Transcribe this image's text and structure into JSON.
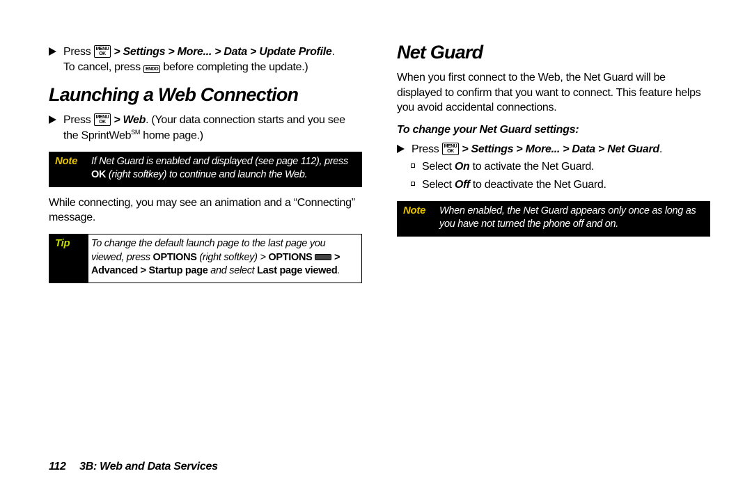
{
  "left": {
    "intro": {
      "press": "Press",
      "path": "> Settings > More... > Data > Update Profile",
      "cancel1": "To cancel, press",
      "cancel2": "before completing the update.)"
    },
    "h1": "Launching a Web Connection",
    "launch": {
      "press": "Press",
      "web": "> Web",
      "rest1": ". (Your data connection starts and you see the SprintWeb",
      "sm": "SM",
      "rest2": " home page.)"
    },
    "note": {
      "label": "Note",
      "body1": "If Net Guard is enabled and displayed (see page 112), press ",
      "ok": "OK",
      "body2": " (right softkey) to continue and launch the Web."
    },
    "connecting": "While connecting, you may see an animation and a “Connecting” message.",
    "tip": {
      "label": "Tip",
      "body1": "To change the default launch page to the last page you viewed, press ",
      "opts": "OPTIONS",
      "body2": " (right softkey) > ",
      "opts2": "OPTIONS",
      "path": " > Advanced > Startup page",
      "body3": " and select ",
      "last": "Last page viewed",
      "period": "."
    }
  },
  "right": {
    "h1": "Net Guard",
    "intro": "When you first connect to the Web, the Net Guard will be displayed to confirm that you want to connect. This feature helps you avoid accidental connections.",
    "sub": "To change your Net Guard settings:",
    "step": {
      "press": "Press",
      "path": "> Settings > More... > Data > Net Guard",
      "period": "."
    },
    "on": {
      "pre": "Select ",
      "kw": "On",
      "post": " to activate the Net Guard."
    },
    "off": {
      "pre": "Select ",
      "kw": "Off",
      "post": " to deactivate the Net Guard."
    },
    "note": {
      "label": "Note",
      "body": "When enabled, the Net Guard appears only once as long as you have not turned the phone off and on."
    }
  },
  "footer": {
    "page": "112",
    "title": "3B: Web and Data Services"
  }
}
